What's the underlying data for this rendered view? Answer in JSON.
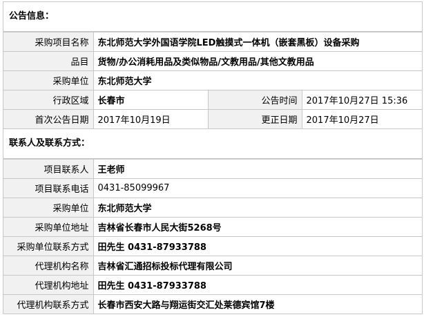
{
  "sections": {
    "notice": "公告信息：",
    "contact": "联系人及联系方式："
  },
  "notice": {
    "project_name_label": "采购项目名称",
    "project_name": "东北师范大学外国语学院LED触摸式一体机（嵌套黑板）设备采购",
    "category_label": "品目",
    "category": "货物/办公消耗用品及类似物品/文教用品/其他文教用品",
    "purchaser_label": "采购单位",
    "purchaser": "东北师范大学",
    "region_label": "行政区域",
    "region": "长春市",
    "publish_time_label": "公告时间",
    "publish_time": "2017年10月27日 15:36",
    "first_date_label": "首次公告日期",
    "first_date": "2017年10月19日",
    "change_date_label": "更正日期",
    "change_date": "2017年10月27日"
  },
  "contact": {
    "project_contact_label": "项目联系人",
    "project_contact": "王老师",
    "project_phone_label": "项目联系电话",
    "project_phone": "0431-85099967",
    "purchaser_label": "采购单位",
    "purchaser": "东北师范大学",
    "purchaser_addr_label": "采购单位地址",
    "purchaser_addr": "吉林省长春市人民大街5268号",
    "purchaser_contact_label": "采购单位联系方式",
    "purchaser_contact": "田先生 0431-87933788",
    "agency_name_label": "代理机构名称",
    "agency_name": "吉林省汇通招标投标代理有限公司",
    "agency_addr_label": "代理机构地址",
    "agency_addr": "田先生 0431-87933788",
    "agency_contact_label": "代理机构联系方式",
    "agency_contact": "长春市西安大路与翔运街交汇处莱德宾馆7楼"
  }
}
